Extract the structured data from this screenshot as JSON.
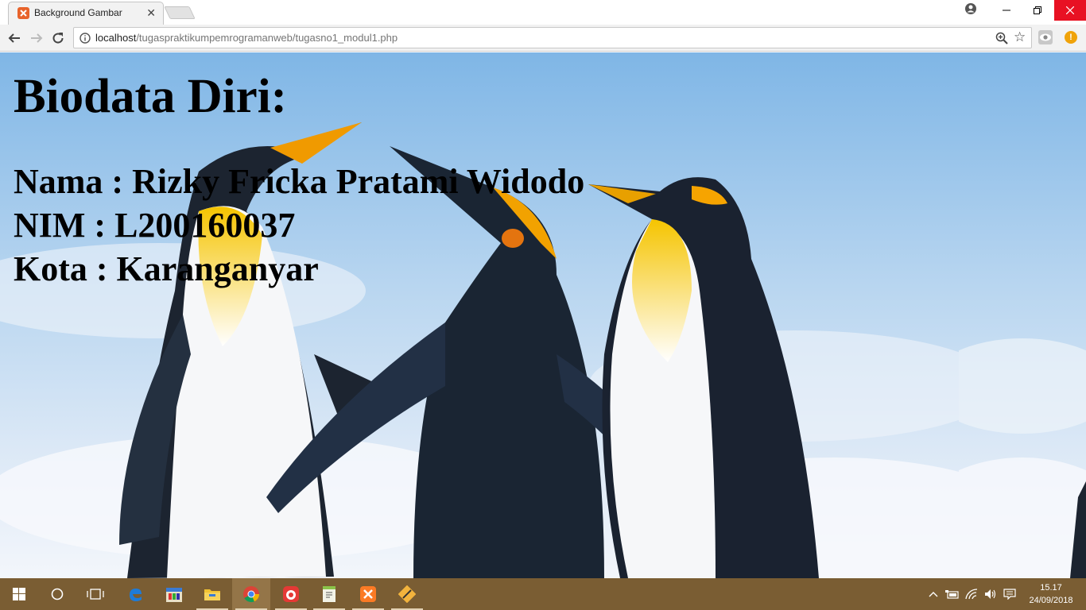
{
  "browser": {
    "tab_title": "Background Gambar",
    "tab_close": "✕",
    "url_host": "localhost",
    "url_path": "/tugaspraktikumpemrogramanweb/tugasno1_modul1.php",
    "extension_badge": "!"
  },
  "page": {
    "heading": "Biodata Diri:",
    "nama": "Nama : Rizky Fricka Pratami Widodo",
    "nim": "NIM : L200160037",
    "kota": "Kota : Karanganyar"
  },
  "taskbar": {
    "time": "15.17",
    "date": "24/09/2018",
    "pinned": [
      "start-icon",
      "cortana-icon",
      "task-view-icon",
      "edge-icon",
      "calendar-app-icon",
      "file-explorer-icon",
      "chrome-icon",
      "media-app-icon",
      "notepad-plus-icon",
      "xampp-icon",
      "editor-app-icon"
    ]
  },
  "colors": {
    "taskbar": "#7a5d33",
    "close_button": "#e81123",
    "sky": "#8fbde6"
  }
}
